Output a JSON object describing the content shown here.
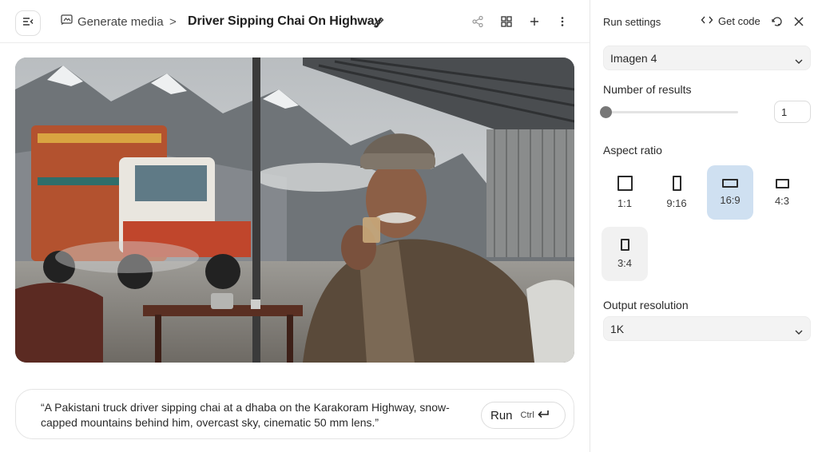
{
  "header": {
    "breadcrumb_label": "Generate media",
    "breadcrumb_separator": ">",
    "title": "Driver Sipping Chai On Highway"
  },
  "image": {
    "alt": "Pakistani truck driver sipping chai at a dhaba with a decorated truck and snow-capped mountains"
  },
  "prompt": {
    "text": "“A Pakistani truck driver sipping chai at a dhaba on the Karakoram Highway, snow-capped mountains behind him, overcast sky, cinematic 50 mm lens.”",
    "run_label": "Run",
    "shortcut_label": "Ctrl"
  },
  "panel": {
    "title": "Run settings",
    "get_code_label": "Get code",
    "model_value": "Imagen 4",
    "num_results_label": "Number of results",
    "num_results_value": "1",
    "aspect_ratio_label": "Aspect ratio",
    "aspect_ratios": [
      {
        "label": "1:1",
        "selected": false
      },
      {
        "label": "9:16",
        "selected": false
      },
      {
        "label": "16:9",
        "selected": true
      },
      {
        "label": "4:3",
        "selected": false
      },
      {
        "label": "3:4",
        "selected": false
      }
    ],
    "output_resolution_label": "Output resolution",
    "output_resolution_value": "1K"
  },
  "icons": {
    "menu": "sidebar-toggle-icon",
    "breadcrumb": "image-generate-icon",
    "edit": "pencil-icon",
    "share": "share-icon",
    "grid": "grid-icon",
    "add": "plus-icon",
    "more": "more-vertical-icon",
    "code": "code-icon",
    "reset": "reset-icon",
    "close": "close-icon",
    "chevron": "chevron-down-icon",
    "enter": "enter-key-icon"
  },
  "colors": {
    "selected_tile": "#cfe0f1",
    "tile": "#f1f1f1",
    "slider_thumb": "#777777"
  }
}
